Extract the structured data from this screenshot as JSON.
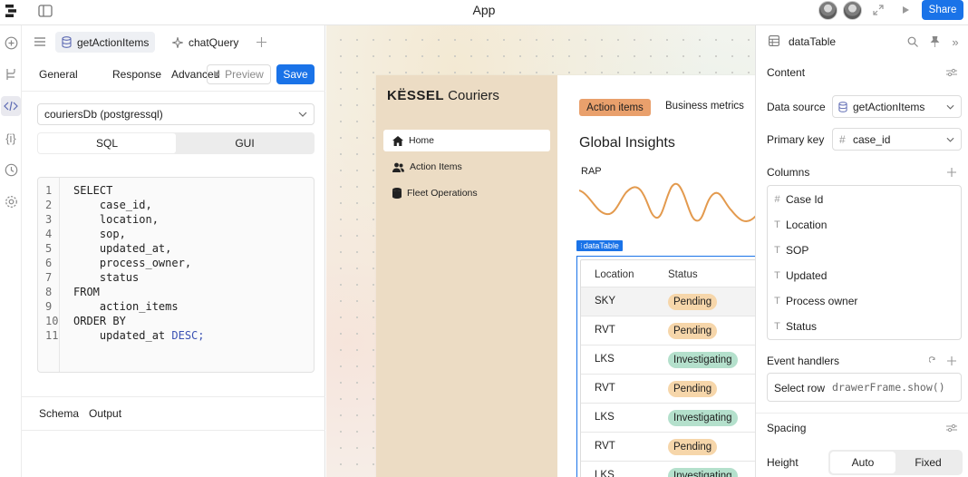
{
  "topbar": {
    "title": "App",
    "share_label": "Share"
  },
  "queries": {
    "tabs": [
      {
        "label": "getActionItems",
        "active": true
      },
      {
        "label": "chatQuery",
        "active": false
      }
    ],
    "subtabs": [
      "General",
      "Response",
      "Advanced"
    ],
    "preview_label": "Preview",
    "save_label": "Save",
    "resource": "couriersDb (postgressql)",
    "mode_tabs": [
      "SQL",
      "GUI"
    ],
    "code_lines": [
      {
        "n": "1",
        "text": "SELECT",
        "kw": true
      },
      {
        "n": "2",
        "text": "    case_id,",
        "kw": false
      },
      {
        "n": "3",
        "text": "    location,",
        "kw": false
      },
      {
        "n": "4",
        "text": "    sop,",
        "kw": false
      },
      {
        "n": "5",
        "text": "    updated_at,",
        "kw": false
      },
      {
        "n": "6",
        "text": "    process_owner,",
        "kw": false
      },
      {
        "n": "7",
        "text": "    status",
        "kw": false
      },
      {
        "n": "8",
        "text": "FROM",
        "kw": true
      },
      {
        "n": "9",
        "text": "    action_items",
        "kw": false
      },
      {
        "n": "10",
        "text": "ORDER BY",
        "kw": true
      },
      {
        "n": "11",
        "text": "    updated_at ",
        "kw": false,
        "suffix_kw": "DESC;"
      }
    ],
    "bottom_tabs": [
      "Schema",
      "Output"
    ]
  },
  "preview_app": {
    "brand_bold": "KËSSEL",
    "brand_rest": " Couriers",
    "nav": [
      {
        "label": "Home",
        "icon": "home-icon",
        "active": true
      },
      {
        "label": "Action Items",
        "icon": "people-icon",
        "active": false
      },
      {
        "label": "Fleet Operations",
        "icon": "database-icon",
        "active": false
      }
    ],
    "tabs": [
      "Action items",
      "Business metrics"
    ],
    "heading": "Global Insights",
    "chart_label": "RAP",
    "selected_component": "dataTable",
    "table": {
      "headers": [
        "Location",
        "Status"
      ],
      "rows": [
        {
          "location": "SKY",
          "status": "Pending"
        },
        {
          "location": "RVT",
          "status": "Pending"
        },
        {
          "location": "LKS",
          "status": "Investigating"
        },
        {
          "location": "RVT",
          "status": "Pending"
        },
        {
          "location": "LKS",
          "status": "Investigating"
        },
        {
          "location": "RVT",
          "status": "Pending"
        },
        {
          "location": "LKS",
          "status": "Investigating"
        }
      ]
    }
  },
  "inspector": {
    "title": "dataTable",
    "content_label": "Content",
    "data_source_label": "Data source",
    "data_source_value": "getActionItems",
    "primary_key_label": "Primary key",
    "primary_key_value": "case_id",
    "columns_label": "Columns",
    "columns": [
      {
        "label": "Case Id",
        "type": "#"
      },
      {
        "label": "Location",
        "type": "T"
      },
      {
        "label": "SOP",
        "type": "T"
      },
      {
        "label": "Updated",
        "type": "T"
      },
      {
        "label": "Process owner",
        "type": "T"
      },
      {
        "label": "Status",
        "type": "T"
      }
    ],
    "event_handlers_label": "Event handlers",
    "handler_event": "Select row",
    "handler_action": "drawerFrame.show()",
    "spacing_label": "Spacing",
    "height_label": "Height",
    "height_options": [
      "Auto",
      "Fixed"
    ]
  },
  "colors": {
    "accent": "#1a73e8",
    "sidebar": "#ecdcc4",
    "pending": "#f6d6aa",
    "investigating": "#b4e0cc",
    "chart_line": "#e39a4e"
  }
}
